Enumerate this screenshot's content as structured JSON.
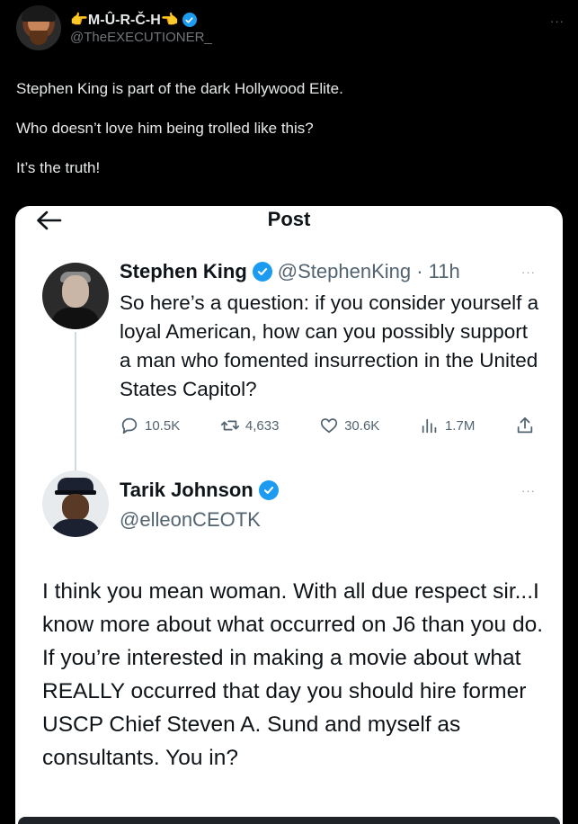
{
  "outer_tweet": {
    "display_name": "👉M-Û-R-Č-H👈",
    "handle": "@TheEXECUTIONER_",
    "more_label": "···",
    "text": [
      "Stephen King is part of the dark Hollywood Elite.",
      "Who doesn’t love him being trolled like this?",
      "It’s the truth!"
    ]
  },
  "embedded": {
    "title": "Post",
    "tweet1": {
      "name": "Stephen King",
      "handle_time": "@StephenKing · 11h",
      "more_label": "···",
      "text": "So here’s a question: if you consider yourself a loyal American, how can you possibly support a man who fomented insurrection in the United States Capitol?",
      "replies": "10.5K",
      "reposts": "4,633",
      "likes": "30.6K",
      "views": "1.7M"
    },
    "tweet2": {
      "name": "Tarik Johnson",
      "handle": "@elleonCEOTK",
      "more_label": "···",
      "text": "I think you mean woman. With all due respect sir...I know more about what occurred on J6 than you do. If you’re interested in making a movie about what REALLY occurred that day you should hire former USCP Chief Steven A. Sund and myself as consultants. You in?"
    }
  },
  "colors": {
    "verified": "#1d9bf0",
    "background": "#000000",
    "card": "#ffffff",
    "secondary_text": "#536471"
  }
}
